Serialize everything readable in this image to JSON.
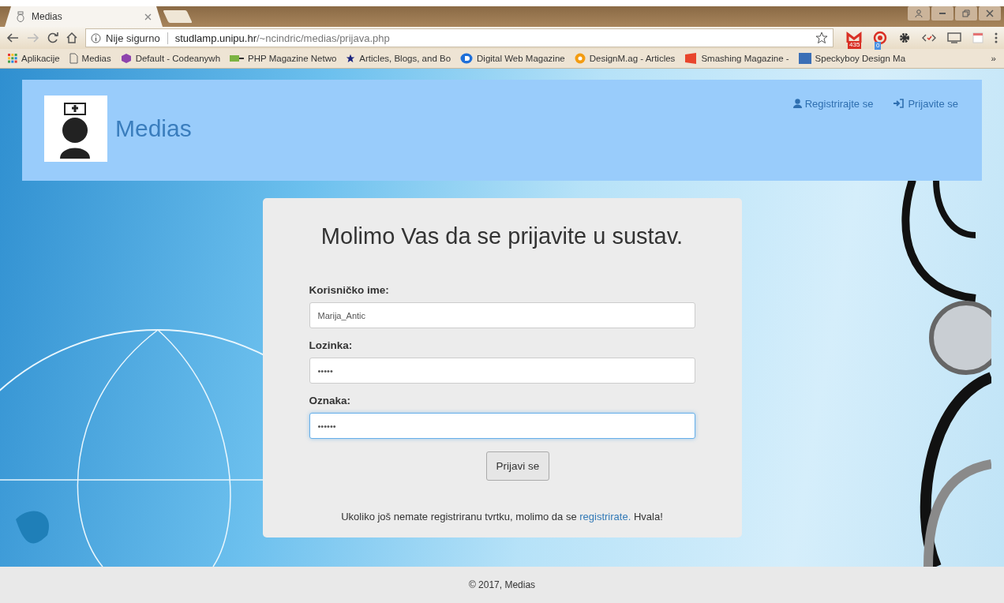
{
  "browser": {
    "tabs": [
      {
        "title": "Medias",
        "selected": true
      }
    ],
    "nav": {
      "security": "Nije sigurno",
      "url_host": "studlamp.unipu.hr",
      "url_path": "/~ncindric/medias/prijava.php"
    },
    "extensions": [
      {
        "kind": "mail",
        "badge": "435",
        "color": "#d93025"
      },
      {
        "kind": "target",
        "badge": "0",
        "color": "#4a90e2"
      },
      {
        "kind": "gear"
      },
      {
        "kind": "code"
      },
      {
        "kind": "cast"
      },
      {
        "kind": "calendar"
      }
    ],
    "bookmarks": [
      {
        "kind": "apps",
        "label": "Aplikacije"
      },
      {
        "kind": "page",
        "label": "Medias"
      },
      {
        "kind": "cube",
        "label": "Default - Codeanywh"
      },
      {
        "kind": "php",
        "label": "PHP Magazine Netwo"
      },
      {
        "kind": "star",
        "label": "Articles, Blogs, and Bo"
      },
      {
        "kind": "d",
        "label": "Digital Web Magazine"
      },
      {
        "kind": "dm",
        "label": "DesignM.ag - Articles"
      },
      {
        "kind": "s",
        "label": "Smashing Magazine -"
      },
      {
        "kind": "bo",
        "label": "Speckyboy Design Ma"
      }
    ],
    "bookmarks_more": "»"
  },
  "header": {
    "brand": "Medias",
    "links": [
      {
        "kind": "register",
        "label": "Registrirajte se"
      },
      {
        "kind": "login",
        "label": "Prijavite se"
      }
    ]
  },
  "login": {
    "title": "Molimo Vas da se prijavite u sustav.",
    "fields": [
      {
        "label": "Korisničko ime:",
        "value": "Marija_Antic",
        "focused": false
      },
      {
        "label": "Lozinka:",
        "value": "•••••",
        "focused": false
      },
      {
        "label": "Oznaka:",
        "value": "••••••",
        "focused": true
      }
    ],
    "button": "Prijavi se",
    "note_before": "Ukoliko još nemate registriranu tvrtku, molimo da se",
    "note_link": "registrirate.",
    "note_after": "Hvala!"
  },
  "footer": "© 2017, Medias"
}
